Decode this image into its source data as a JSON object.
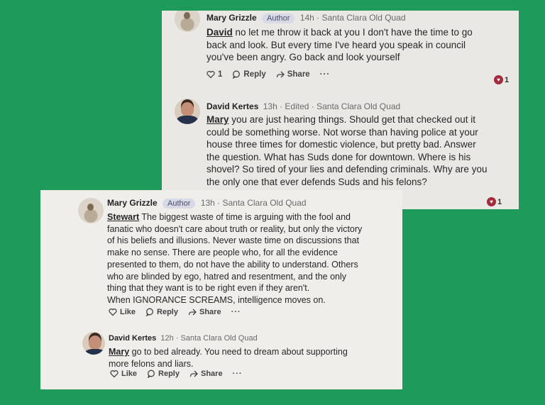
{
  "comments": [
    {
      "author": "Mary Grizzle",
      "badge": "Author",
      "meta": "14h · Santa Clara Old Quad",
      "mention": "David",
      "lines": [
        " no let me throw it back at you I don't have the time to go",
        "back and look. But every time I've heard you speak in council",
        "you've been angry.   Go back and look yourself"
      ],
      "like_label": "1",
      "reply_label": "Reply",
      "share_label": "Share",
      "more_label": "···",
      "reaction_count": "1"
    },
    {
      "author": "David Kertes",
      "meta": "13h · Edited · Santa Clara Old Quad",
      "mention": "Mary",
      "lines": [
        " you are just hearing things. Should get that checked out it",
        "could be something worse. Not worse than having police at your",
        "house three times for domestic violence, but pretty bad. Answer",
        "the question. What has Suds done for downtown. Where is his",
        "shovel?  So tired of your lies and defending criminals. Why are you",
        "the only one that ever defends Suds and his felons?"
      ],
      "reaction_count": "1"
    },
    {
      "author": "Mary Grizzle",
      "badge": "Author",
      "meta": "13h · Santa Clara Old Quad",
      "mention": "Stewart",
      "lines": [
        " The biggest waste of time is arguing with the fool and",
        "fanatic who doesn't care about truth or reality, but only the victory",
        "of his beliefs and illusions. Never waste time on discussions that",
        "make no sense. There are people who, for all the evidence",
        "presented to them, do not have the ability to understand. Others",
        "who are blinded by ego, hatred and resentment, and the only",
        "thing that they want is to be right even if they aren't.",
        "When IGNORANCE SCREAMS, intelligence moves on."
      ],
      "like_label": "Like",
      "reply_label": "Reply",
      "share_label": "Share",
      "more_label": "···"
    },
    {
      "author": "David Kertes",
      "meta": "12h · Santa Clara Old Quad",
      "mention": "Mary",
      "lines": [
        " go to bed already. You need to dream about supporting",
        "more felons and liars."
      ],
      "like_label": "Like",
      "reply_label": "Reply",
      "share_label": "Share",
      "more_label": "···"
    }
  ],
  "colors": {
    "background": "#1e9a5a",
    "badge": "#d7d9e6",
    "reaction": "#a3293b"
  },
  "icons": [
    "heart-icon",
    "reply-bubble-icon",
    "share-arrow-icon"
  ]
}
